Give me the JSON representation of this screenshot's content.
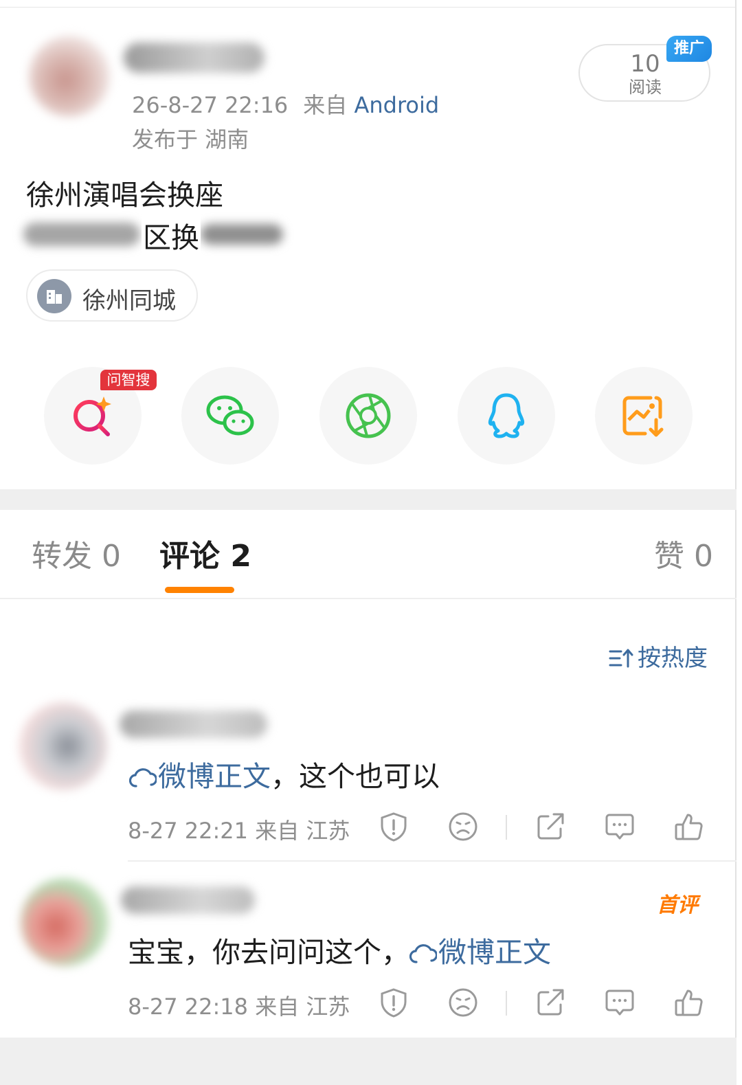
{
  "post": {
    "timestamp": "26-8-27 22:16",
    "from_label": "来自",
    "source": "Android",
    "location": "发布于 湖南",
    "read_count": "10",
    "read_label": "阅读",
    "promo_badge": "推广",
    "text_line1": "徐州演唱会换座",
    "text_line2_visible": "区换",
    "topic": "徐州同城"
  },
  "share_bar": {
    "ai_search_badge": "问智搜",
    "icons": [
      "ai-search-icon",
      "wechat-icon",
      "moments-icon",
      "qq-icon",
      "save-image-icon"
    ]
  },
  "tabs": {
    "repost": "转发 0",
    "comment": "评论 2",
    "like": "赞 0"
  },
  "sort_label": "按热度",
  "comments": [
    {
      "link_text": "微博正文",
      "text": "，这个也可以",
      "time": "8-27 22:21",
      "from": "来自 江苏"
    },
    {
      "text": "宝宝，你去问问这个，",
      "link_text": "微博正文",
      "time": "8-27 22:18",
      "from": "来自 江苏",
      "badge": "首评"
    }
  ],
  "colors": {
    "accent_orange": "#ff8200",
    "link_blue": "#3d6b9e",
    "promo_blue": "#2a97ec",
    "ai_badge_red": "#e3343c"
  }
}
